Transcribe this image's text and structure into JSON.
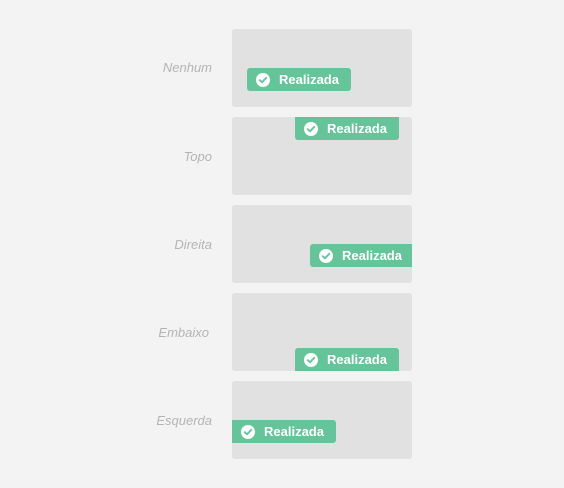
{
  "colors": {
    "page_background": "#f3f3f3",
    "panel_background": "#e1e1e1",
    "badge_background": "#66c49a",
    "badge_text": "#ffffff",
    "label_text": "#b4b4b4"
  },
  "rows": [
    {
      "label": "Nenhum",
      "badge": {
        "icon": "check-circle-icon",
        "text": "Realizada"
      }
    },
    {
      "label": "Topo",
      "badge": {
        "icon": "check-circle-icon",
        "text": "Realizada"
      }
    },
    {
      "label": "Direita",
      "badge": {
        "icon": "check-circle-icon",
        "text": "Realizada"
      }
    },
    {
      "label": "Embaixo",
      "badge": {
        "icon": "check-circle-icon",
        "text": "Realizada"
      }
    },
    {
      "label": "Esquerda",
      "badge": {
        "icon": "check-circle-icon",
        "text": "Realizada"
      }
    }
  ]
}
